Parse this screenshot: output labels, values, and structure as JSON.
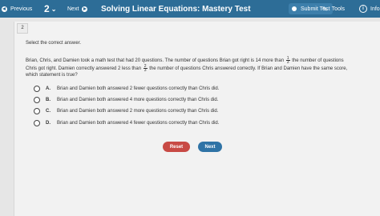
{
  "topbar": {
    "previous_label": "Previous",
    "question_number": "2",
    "next_label": "Next",
    "title": "Solving Linear Equations: Mastery Test",
    "submit_label": "Submit Test",
    "tools_label": "Tools",
    "info_label": "Info"
  },
  "question": {
    "badge": "2",
    "instruction": "Select the correct answer.",
    "stem_part1": "Brian, Chris, and Damien took a math test that had 20 questions. The number of questions Brian got right is 14 more than",
    "frac1_num": "1",
    "frac1_den": "3",
    "stem_part2": "the number of questions Chris got right. Damien correctly answered 2 less than",
    "frac2_num": "2",
    "frac2_den": "3",
    "stem_part3": "the number of questions Chris answered correctly. If Brian and Damien have the same score, which statement is true?",
    "options": [
      {
        "letter": "A.",
        "text": "Brian and Damien both answered 2 fewer questions correctly than Chris did."
      },
      {
        "letter": "B.",
        "text": "Brian and Damien both answered 4 more questions correctly than Chris did."
      },
      {
        "letter": "C.",
        "text": "Brian and Damien both answered 2 more questions correctly than Chris did."
      },
      {
        "letter": "D.",
        "text": "Brian and Damien both answered 4 fewer questions correctly than Chris did."
      }
    ]
  },
  "buttons": {
    "reset_label": "Reset",
    "next_label": "Next"
  },
  "colors": {
    "topbar": "#2d6d97",
    "reset": "#c84a45",
    "next": "#2f73a6"
  }
}
